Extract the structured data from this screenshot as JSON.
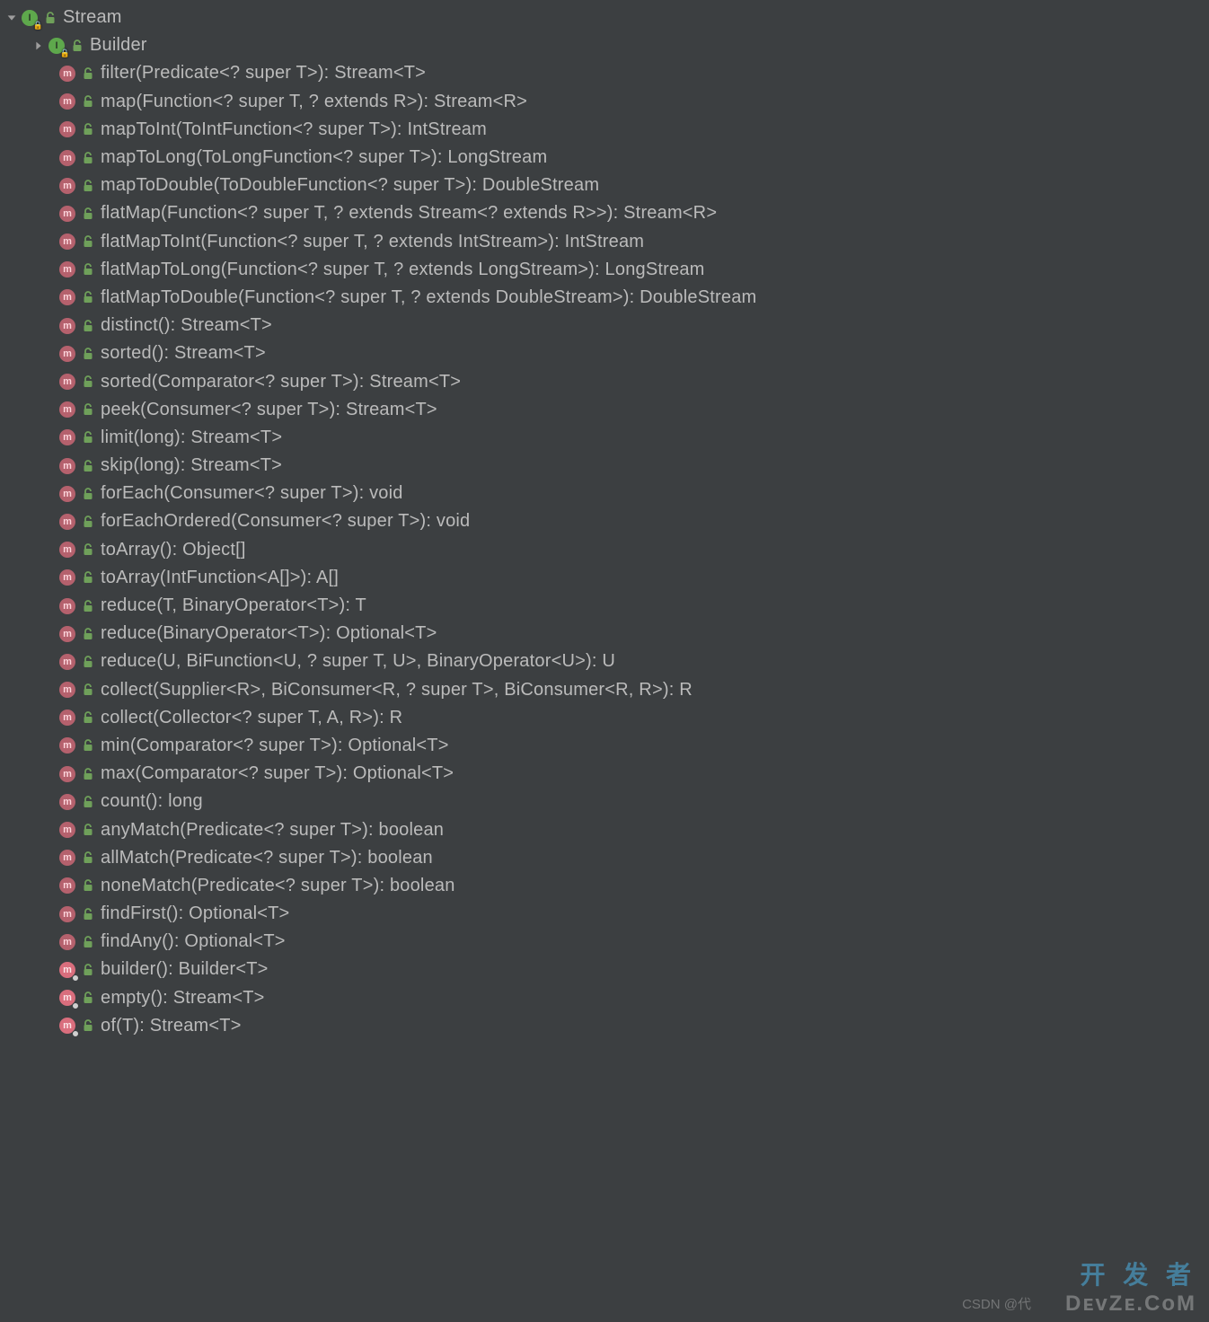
{
  "root": {
    "label": "Stream",
    "iconLetter": "I"
  },
  "child": {
    "label": "Builder",
    "iconLetter": "I"
  },
  "methods": [
    {
      "label": "filter(Predicate<? super T>): Stream<T>",
      "iconLetter": "m",
      "static": false
    },
    {
      "label": "map(Function<? super T, ? extends R>): Stream<R>",
      "iconLetter": "m",
      "static": false
    },
    {
      "label": "mapToInt(ToIntFunction<? super T>): IntStream",
      "iconLetter": "m",
      "static": false
    },
    {
      "label": "mapToLong(ToLongFunction<? super T>): LongStream",
      "iconLetter": "m",
      "static": false
    },
    {
      "label": "mapToDouble(ToDoubleFunction<? super T>): DoubleStream",
      "iconLetter": "m",
      "static": false
    },
    {
      "label": "flatMap(Function<? super T, ? extends Stream<? extends R>>): Stream<R>",
      "iconLetter": "m",
      "static": false
    },
    {
      "label": "flatMapToInt(Function<? super T, ? extends IntStream>): IntStream",
      "iconLetter": "m",
      "static": false
    },
    {
      "label": "flatMapToLong(Function<? super T, ? extends LongStream>): LongStream",
      "iconLetter": "m",
      "static": false
    },
    {
      "label": "flatMapToDouble(Function<? super T, ? extends DoubleStream>): DoubleStream",
      "iconLetter": "m",
      "static": false
    },
    {
      "label": "distinct(): Stream<T>",
      "iconLetter": "m",
      "static": false
    },
    {
      "label": "sorted(): Stream<T>",
      "iconLetter": "m",
      "static": false
    },
    {
      "label": "sorted(Comparator<? super T>): Stream<T>",
      "iconLetter": "m",
      "static": false
    },
    {
      "label": "peek(Consumer<? super T>): Stream<T>",
      "iconLetter": "m",
      "static": false
    },
    {
      "label": "limit(long): Stream<T>",
      "iconLetter": "m",
      "static": false
    },
    {
      "label": "skip(long): Stream<T>",
      "iconLetter": "m",
      "static": false
    },
    {
      "label": "forEach(Consumer<? super T>): void",
      "iconLetter": "m",
      "static": false
    },
    {
      "label": "forEachOrdered(Consumer<? super T>): void",
      "iconLetter": "m",
      "static": false
    },
    {
      "label": "toArray(): Object[]",
      "iconLetter": "m",
      "static": false
    },
    {
      "label": "toArray(IntFunction<A[]>): A[]",
      "iconLetter": "m",
      "static": false
    },
    {
      "label": "reduce(T, BinaryOperator<T>): T",
      "iconLetter": "m",
      "static": false
    },
    {
      "label": "reduce(BinaryOperator<T>): Optional<T>",
      "iconLetter": "m",
      "static": false
    },
    {
      "label": "reduce(U, BiFunction<U, ? super T, U>, BinaryOperator<U>): U",
      "iconLetter": "m",
      "static": false
    },
    {
      "label": "collect(Supplier<R>, BiConsumer<R, ? super T>, BiConsumer<R, R>): R",
      "iconLetter": "m",
      "static": false
    },
    {
      "label": "collect(Collector<? super T, A, R>): R",
      "iconLetter": "m",
      "static": false
    },
    {
      "label": "min(Comparator<? super T>): Optional<T>",
      "iconLetter": "m",
      "static": false
    },
    {
      "label": "max(Comparator<? super T>): Optional<T>",
      "iconLetter": "m",
      "static": false
    },
    {
      "label": "count(): long",
      "iconLetter": "m",
      "static": false
    },
    {
      "label": "anyMatch(Predicate<? super T>): boolean",
      "iconLetter": "m",
      "static": false
    },
    {
      "label": "allMatch(Predicate<? super T>): boolean",
      "iconLetter": "m",
      "static": false
    },
    {
      "label": "noneMatch(Predicate<? super T>): boolean",
      "iconLetter": "m",
      "static": false
    },
    {
      "label": "findFirst(): Optional<T>",
      "iconLetter": "m",
      "static": false
    },
    {
      "label": "findAny(): Optional<T>",
      "iconLetter": "m",
      "static": false
    },
    {
      "label": "builder(): Builder<T>",
      "iconLetter": "m",
      "static": true
    },
    {
      "label": "empty(): Stream<T>",
      "iconLetter": "m",
      "static": true
    },
    {
      "label": "of(T): Stream<T>",
      "iconLetter": "m",
      "static": true
    }
  ],
  "watermarks": {
    "top": "开 发 者",
    "bottom": "DᴇᴠZᴇ.CᴏM",
    "csdn": "CSDN @代"
  }
}
